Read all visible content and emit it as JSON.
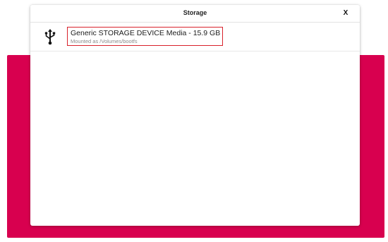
{
  "dialog": {
    "title": "Storage",
    "close_label": "X"
  },
  "storage_items": [
    {
      "icon": "usb-icon",
      "name": "Generic STORAGE DEVICE Media - 15.9 GB",
      "mount": "Mounted as /Volumes/bootfs"
    }
  ],
  "colors": {
    "accent_background": "#d8004f",
    "highlight_border": "#d8212b"
  }
}
